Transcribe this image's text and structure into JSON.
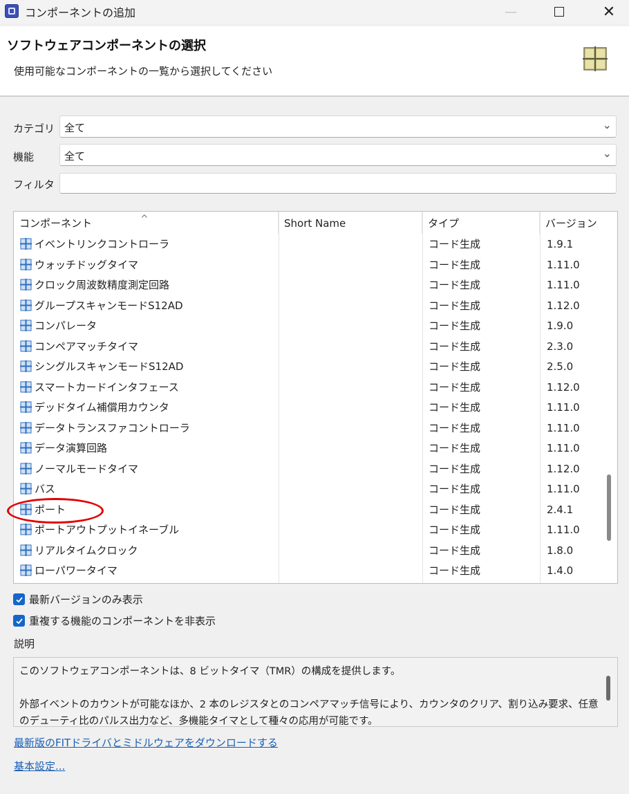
{
  "window": {
    "title": "コンポーネントの追加",
    "minimize": "—",
    "close": "✕"
  },
  "header": {
    "title": "ソフトウェアコンポーネントの選択",
    "subtitle": "使用可能なコンポーネントの一覧から選択してください",
    "icon": "component-grid-icon"
  },
  "form": {
    "category_label": "カテゴリ",
    "category_value": "全て",
    "function_label": "機能",
    "function_value": "全て",
    "filter_label": "フィルタ",
    "filter_value": ""
  },
  "table": {
    "columns": [
      "コンポーネント",
      "Short Name",
      "タイプ",
      "バージョン"
    ],
    "sort_indicator": "^",
    "rows": [
      {
        "name": "イベントリンクコントローラ",
        "short": "",
        "type": "コード生成",
        "version": "1.9.1"
      },
      {
        "name": "ウォッチドッグタイマ",
        "short": "",
        "type": "コード生成",
        "version": "1.11.0"
      },
      {
        "name": "クロック周波数精度測定回路",
        "short": "",
        "type": "コード生成",
        "version": "1.11.0"
      },
      {
        "name": "グループスキャンモードS12AD",
        "short": "",
        "type": "コード生成",
        "version": "1.12.0"
      },
      {
        "name": "コンパレータ",
        "short": "",
        "type": "コード生成",
        "version": "1.9.0"
      },
      {
        "name": "コンペアマッチタイマ",
        "short": "",
        "type": "コード生成",
        "version": "2.3.0"
      },
      {
        "name": "シングルスキャンモードS12AD",
        "short": "",
        "type": "コード生成",
        "version": "2.5.0"
      },
      {
        "name": "スマートカードインタフェース",
        "short": "",
        "type": "コード生成",
        "version": "1.12.0"
      },
      {
        "name": "デッドタイム補償用カウンタ",
        "short": "",
        "type": "コード生成",
        "version": "1.11.0"
      },
      {
        "name": "データトランスファコントローラ",
        "short": "",
        "type": "コード生成",
        "version": "1.11.0"
      },
      {
        "name": "データ演算回路",
        "short": "",
        "type": "コード生成",
        "version": "1.11.0"
      },
      {
        "name": "ノーマルモードタイマ",
        "short": "",
        "type": "コード生成",
        "version": "1.12.0"
      },
      {
        "name": "バス",
        "short": "",
        "type": "コード生成",
        "version": "1.11.0"
      },
      {
        "name": "ポート",
        "short": "",
        "type": "コード生成",
        "version": "2.4.1"
      },
      {
        "name": "ポートアウトプットイネーブル",
        "short": "",
        "type": "コード生成",
        "version": "1.11.0"
      },
      {
        "name": "リアルタイムクロック",
        "short": "",
        "type": "コード生成",
        "version": "1.8.0"
      },
      {
        "name": "ローパワータイマ",
        "short": "",
        "type": "コード生成",
        "version": "1.4.0"
      }
    ],
    "row_icon": "component-grid-icon",
    "highlighted_row": "ポート",
    "highlight_color": "#e00000"
  },
  "options": {
    "latest_only_label": "最新バージョンのみ表示",
    "latest_only_checked": true,
    "hide_duplicates_label": "重複する機能のコンポーネントを非表示",
    "hide_duplicates_checked": true
  },
  "description": {
    "label": "説明",
    "paragraph1": "このソフトウェアコンポーネントは、8 ビットタイマ（TMR）の構成を提供します。",
    "paragraph2": "外部イベントのカウントが可能なほか、2 本のレジスタとのコンペアマッチ信号により、カウンタのクリア、割り込み要求、任意のデューティ比のパルス出力など、多機能タイマとして種々の応用が可能です。"
  },
  "links": {
    "download": "最新版のFITドライバとミドルウェアをダウンロードする",
    "basic_settings": "基本設定..."
  },
  "colors": {
    "accent": "#1466c8",
    "link": "#1a5fb4",
    "icon_blue": "#2f6fc0"
  }
}
